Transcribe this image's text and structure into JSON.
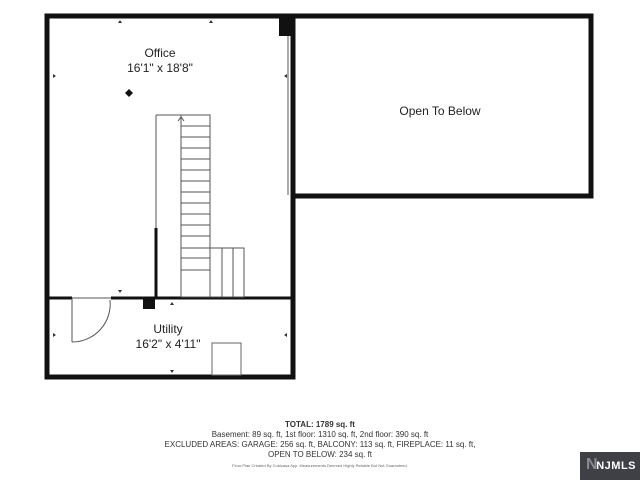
{
  "rooms": {
    "office": {
      "name": "Office",
      "dimensions": "16'1\" x 18'8\""
    },
    "open_to_below": {
      "name": "Open To Below"
    },
    "utility": {
      "name": "Utility",
      "dimensions": "16'2\" x 4'11\""
    }
  },
  "summary": {
    "total": "TOTAL: 1789 sq. ft",
    "line1": "Basement: 89 sq. ft, 1st floor: 1310 sq. ft, 2nd floor: 390 sq. ft",
    "line2": "EXCLUDED AREAS: GARAGE: 256 sq. ft, BALCONY: 113 sq. ft, FIREPLACE: 11 sq. ft,",
    "line3": "OPEN TO BELOW: 234 sq. ft",
    "disclaimer": "Floor Plan Created By Cubicasa App. Measurements Deemed Highly Reliable But Not Guaranteed."
  },
  "logo": {
    "text": "NJMLS"
  },
  "colors": {
    "wall": "#111111",
    "thin_line": "#555555",
    "background": "#ffffff"
  }
}
